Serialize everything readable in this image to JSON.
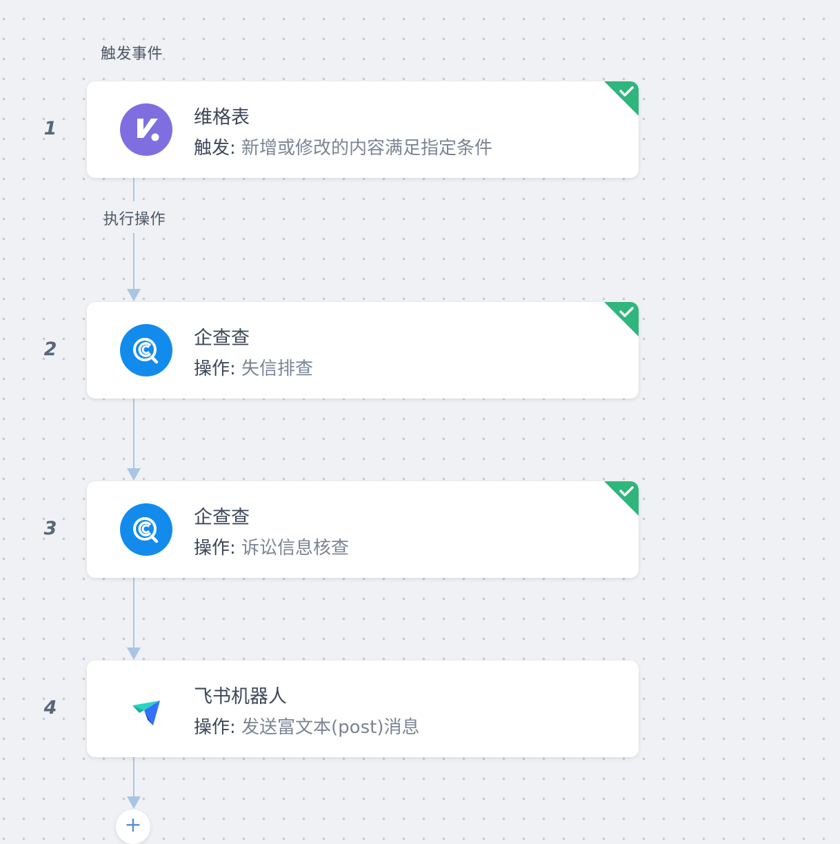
{
  "flow": {
    "trigger_label": "触发事件",
    "action_label": "执行操作",
    "steps": [
      {
        "number": "1",
        "app": "维格表",
        "kind": "触发:",
        "detail": "新增或修改的内容满足指定条件",
        "logo": "vika-logo-icon",
        "configured": true
      },
      {
        "number": "2",
        "app": "企查查",
        "kind": "操作:",
        "detail": "失信排查",
        "logo": "qichacha-logo-icon",
        "configured": true
      },
      {
        "number": "3",
        "app": "企查查",
        "kind": "操作:",
        "detail": "诉讼信息核查",
        "logo": "qichacha-logo-icon",
        "configured": true
      },
      {
        "number": "4",
        "app": "飞书机器人",
        "kind": "操作:",
        "detail": "发送富文本(post)消息",
        "logo": "feishu-bot-logo-icon",
        "configured": false
      }
    ],
    "add_step": "+"
  },
  "colors": {
    "vika": "#7f6ee0",
    "qichacha": "#128bed",
    "check_badge": "#2fb67c",
    "connector": "#a9c5e4"
  }
}
